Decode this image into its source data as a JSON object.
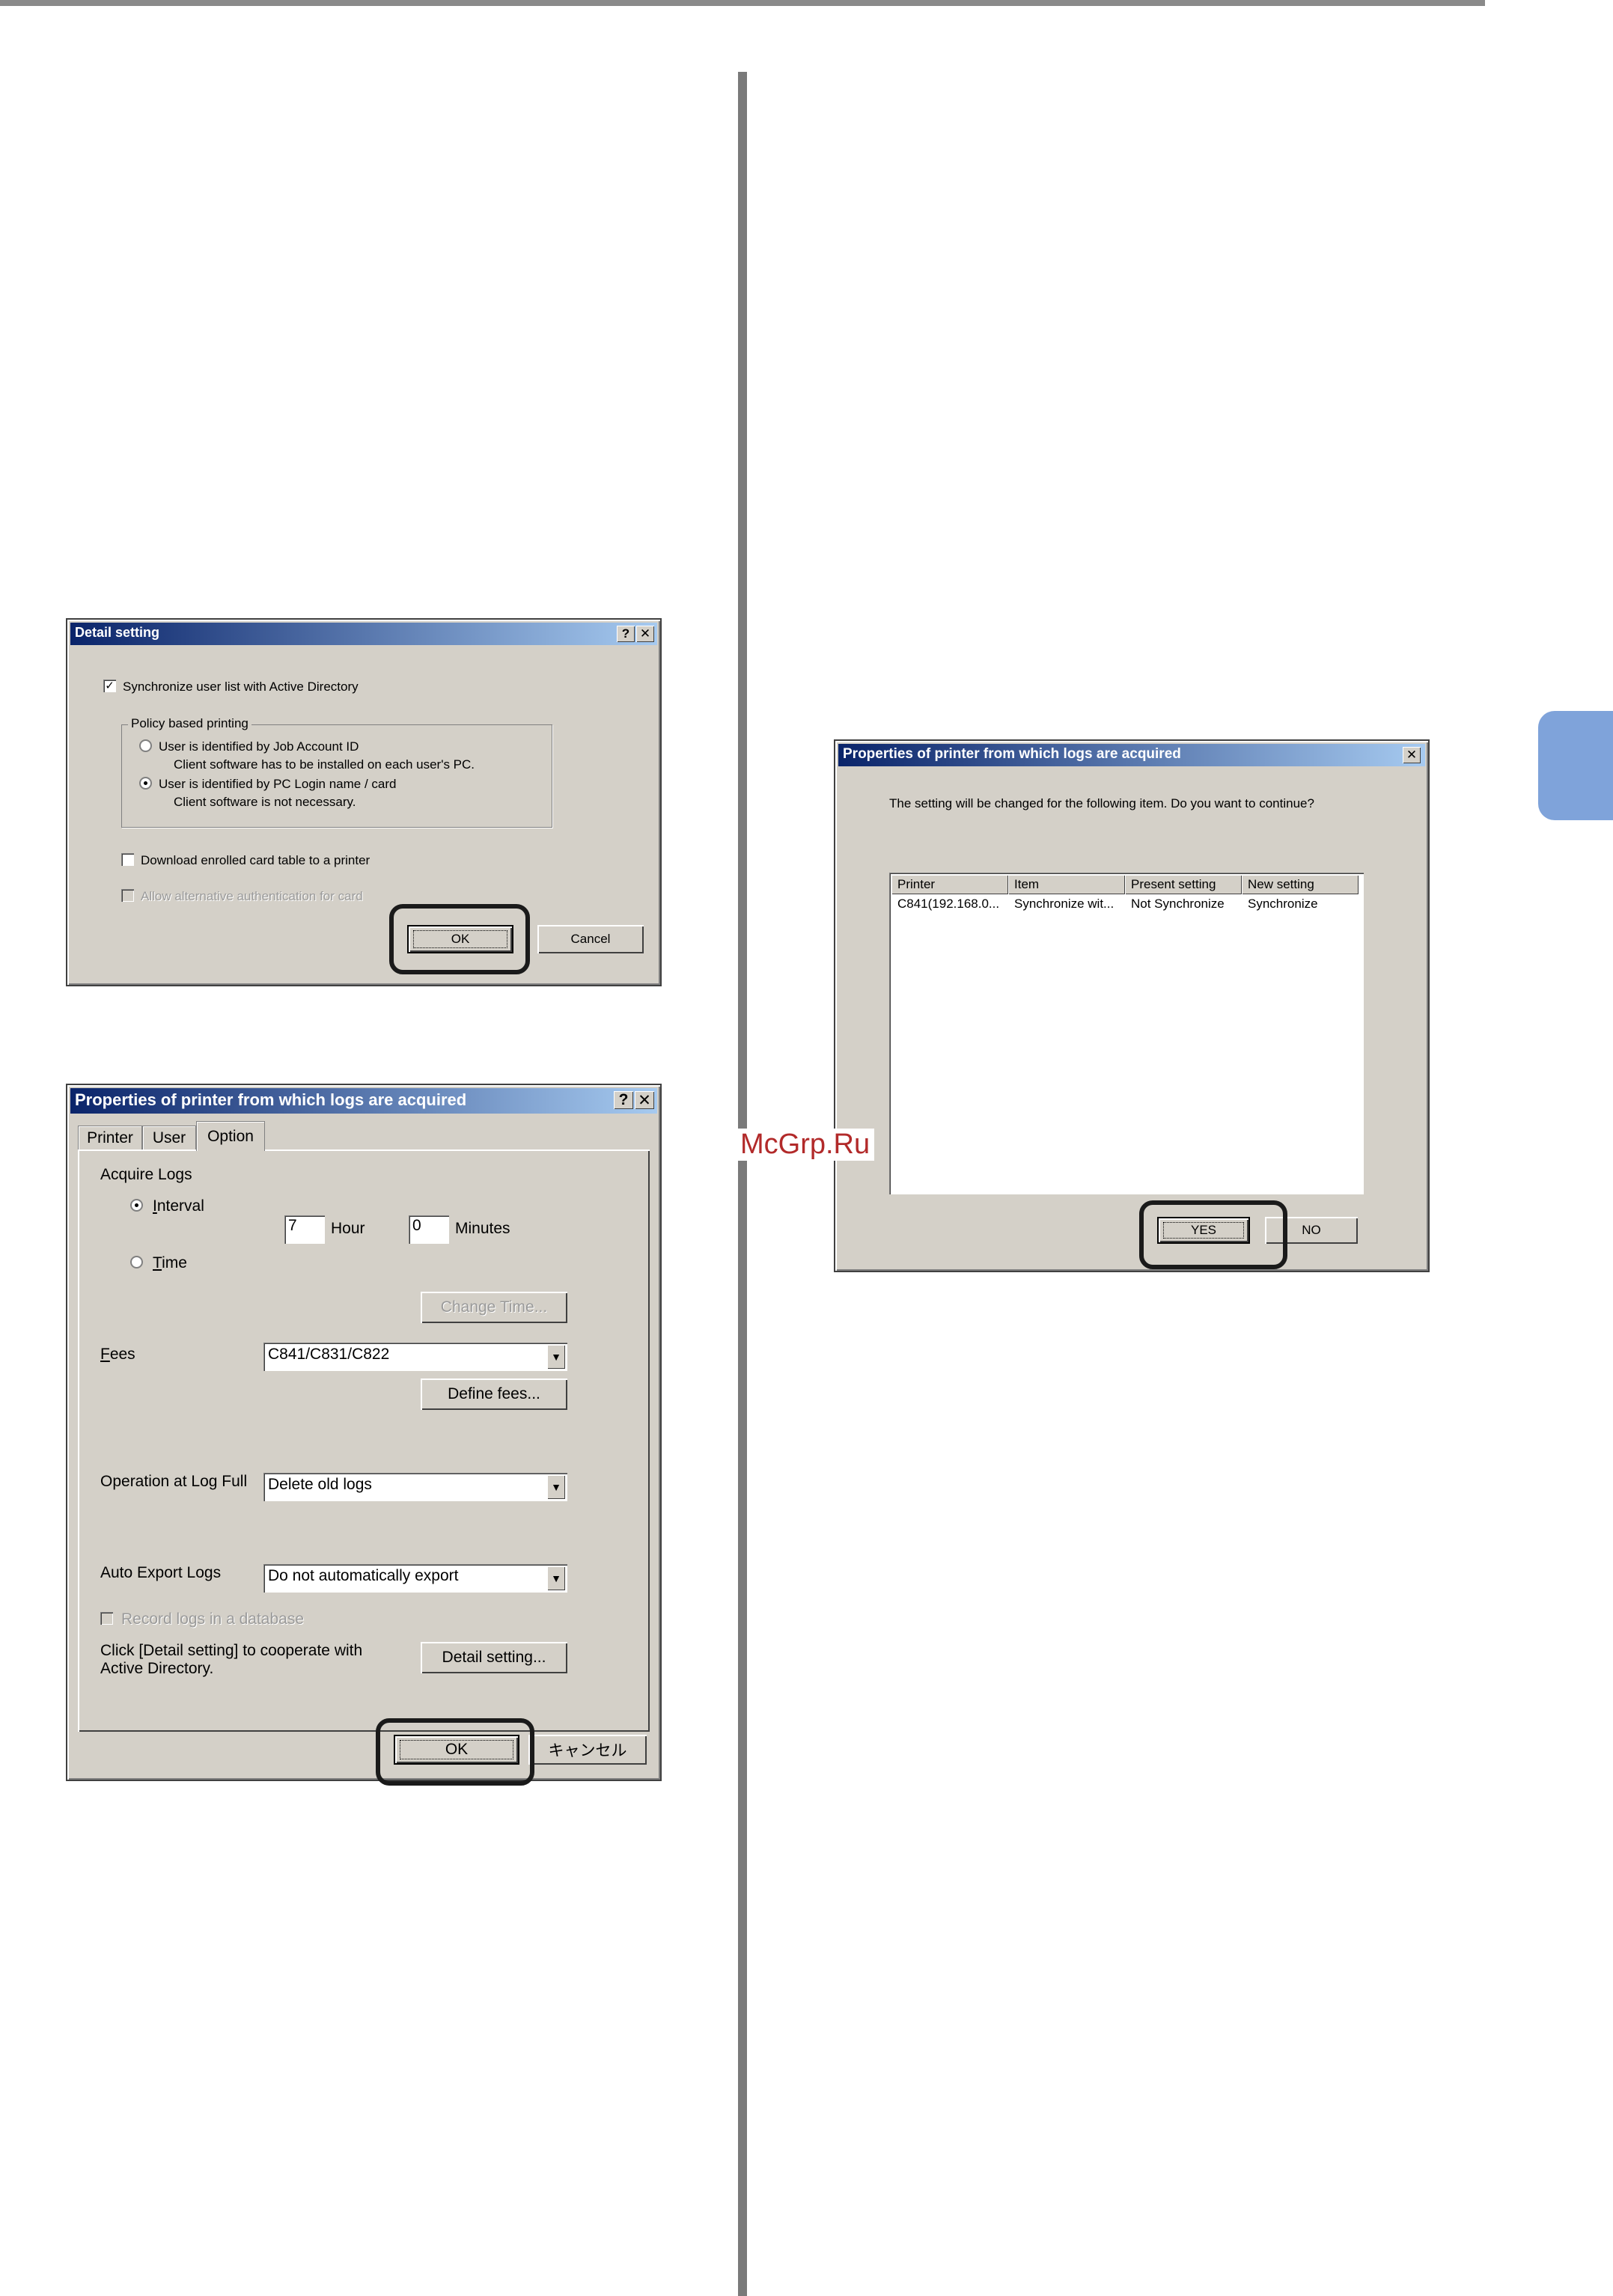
{
  "watermark": "McGrp.Ru",
  "detail_dialog": {
    "title": "Detail setting",
    "help": "?",
    "close": "✕",
    "sync_label": "Synchronize user list with Active Directory",
    "policy_group": "Policy based printing",
    "radio_job_account": "User is identified by Job Account ID",
    "radio_job_account_note": "Client software has to be installed on each user's PC.",
    "radio_pc_login": "User is identified by PC Login name / card",
    "radio_pc_login_note": "Client software is not necessary.",
    "download_card_label": "Download enrolled card table to a printer",
    "allow_alt_label": "Allow alternative authentication for card",
    "ok": "OK",
    "cancel": "Cancel"
  },
  "props_dialog": {
    "title": "Properties of printer from which logs are acquired",
    "help": "?",
    "close": "✕",
    "tabs": [
      "Printer",
      "User",
      "Option"
    ],
    "acquire_logs": "Acquire Logs",
    "interval": "Interval",
    "interval_hour": "7",
    "hour_label": "Hour",
    "interval_minutes": "0",
    "minutes_label": "Minutes",
    "time": "Time",
    "change_time": "Change Time...",
    "fees_label": "Fees",
    "fees_value": "C841/C831/C822",
    "define_fees": "Define fees...",
    "op_log_full_label": "Operation at Log Full",
    "op_log_full_value": "Delete old logs",
    "auto_export_label": "Auto Export Logs",
    "auto_export_value": "Do not automatically export",
    "record_db": "Record logs in a database",
    "ad_note_line1": "Click [Detail setting] to cooperate with",
    "ad_note_line2": "Active Directory.",
    "detail_setting_btn": "Detail setting...",
    "ok": "OK",
    "cancel": "キャンセル"
  },
  "confirm_dialog": {
    "title": "Properties of printer from which logs are acquired",
    "close": "✕",
    "message": "The setting will be changed for the following item. Do you want to continue?",
    "columns": [
      "Printer",
      "Item",
      "Present setting",
      "New setting"
    ],
    "rows": [
      [
        "C841(192.168.0...",
        "Synchronize wit...",
        "Not Synchronize",
        "Synchronize"
      ]
    ],
    "yes": "YES",
    "no": "NO"
  },
  "colors": {
    "dialog_face": "#d4d0c8",
    "title_start": "#0a246a",
    "title_end": "#a6caf0",
    "side_tab": "#7fa3da",
    "watermark": "#b22a2a"
  }
}
